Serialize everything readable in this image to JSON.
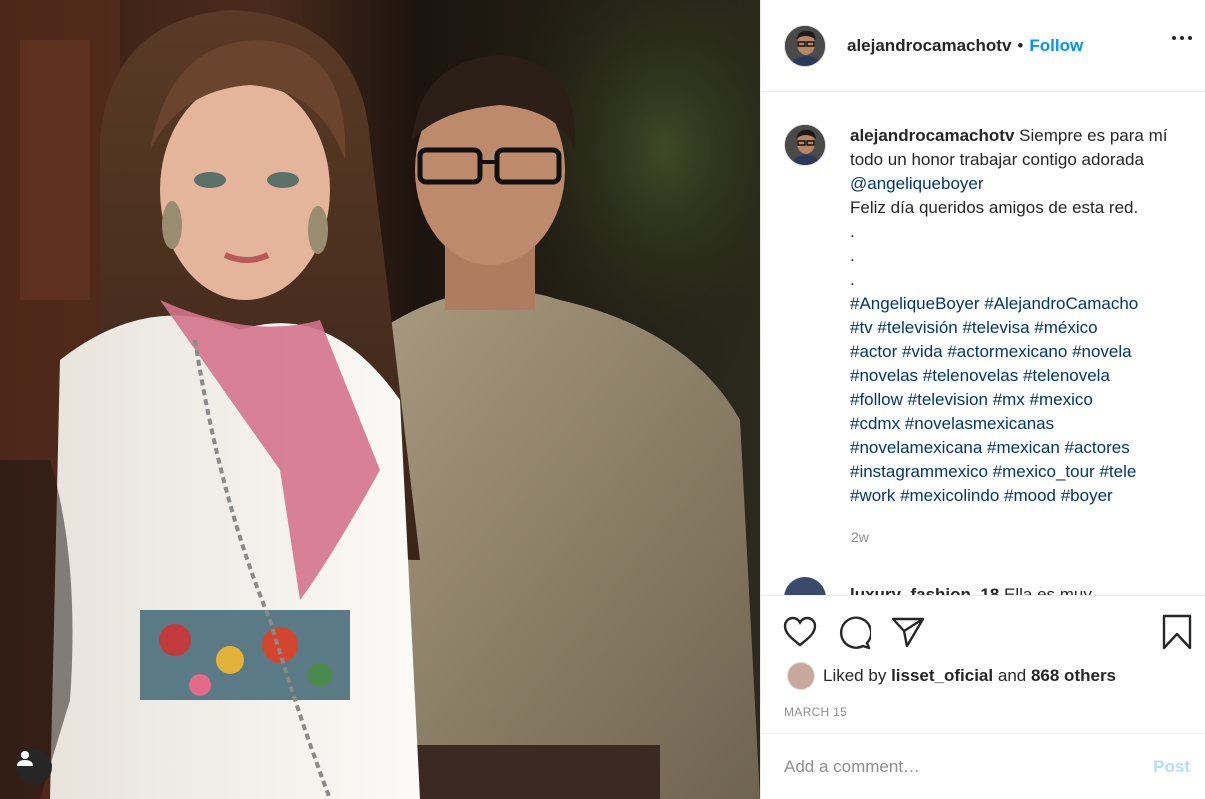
{
  "post": {
    "author": "alejandrocamachotv",
    "follow_label": "Follow",
    "separator": "•",
    "caption": {
      "username": "alejandrocamachotv",
      "text_before_mention": "Siempre es para mí todo un honor trabajar contigo adorada",
      "mention": "@angeliqueboyer",
      "line2": "Feliz día queridos amigos de esta red.",
      "dot": ".",
      "hashtags": [
        "#AngeliqueBoyer #AlejandroCamacho",
        "#tv #televisión #televisa #méxico",
        "#actor #vida #actormexicano #novela",
        "#novelas #telenovelas #telenovela",
        "#follow #television #mx #mexico",
        "#cdmx #novelasmexicanas",
        "#novelamexicana #mexican #actores",
        "#instagrammexico #mexico_tour #tele",
        "#work #mexicolindo #mood #boyer"
      ]
    },
    "time_ago": "2w",
    "next_comment": {
      "username": "luxury_fashion_18",
      "text": "Ella es muy"
    },
    "likes": {
      "prefix": "Liked by",
      "user": "lisset_oficial",
      "and": "and",
      "count": "868 others"
    },
    "date": "MARCH 15",
    "comment_box": {
      "placeholder": "Add a comment…",
      "post_label": "Post"
    }
  },
  "colors": {
    "accent": "#0095f6",
    "link": "#00376b",
    "muted": "#8e8e8e",
    "post_disabled": "#b2dffc"
  },
  "icons": [
    "user-tag-icon",
    "more-options-icon",
    "heart-icon",
    "comment-icon",
    "share-icon",
    "bookmark-icon"
  ]
}
